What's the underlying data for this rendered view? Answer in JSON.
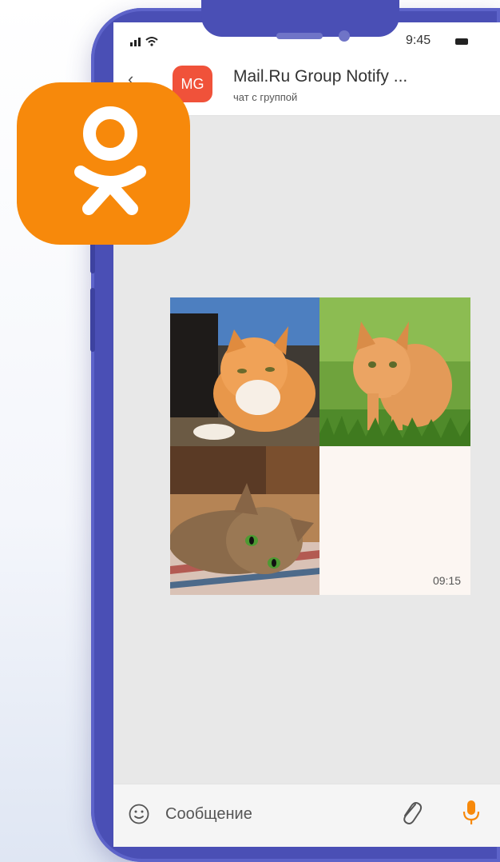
{
  "status_bar": {
    "time": "9:45",
    "signal_icon": "signal-wifi-icon",
    "battery_icon": "battery-icon"
  },
  "header": {
    "back_icon": "chevron-left-icon",
    "avatar_initials": "MG",
    "avatar_color": "#f0523a",
    "title": "Mail.Ru Group Notify ...",
    "subtitle": "чат с группой"
  },
  "overlay_logo": {
    "icon": "odnoklassniki-logo",
    "color": "#f7890b"
  },
  "message": {
    "photos": [
      "cat-photo-orange-lying",
      "cat-photo-orange-in-grass",
      "cat-photo-tabby-lying"
    ],
    "time": "09:15"
  },
  "composer": {
    "emoji_icon": "smiley-icon",
    "placeholder": "Сообщение",
    "attach_icon": "paperclip-icon",
    "mic_icon": "microphone-icon",
    "mic_color": "#f7890b"
  },
  "theme": {
    "phone_frame": "#4a4fb5",
    "chat_background": "#e8e8e8"
  }
}
